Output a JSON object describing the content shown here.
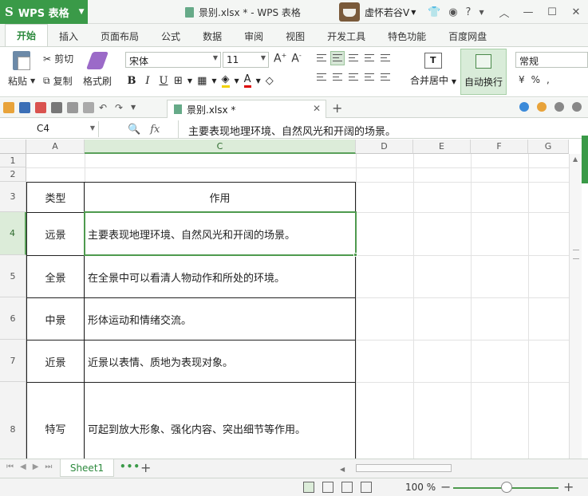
{
  "titlebar": {
    "app_button": "WPS 表格",
    "doc_title": "景别.xlsx * - WPS 表格",
    "user_name": "虚怀若谷V"
  },
  "ribbon_tabs": [
    "开始",
    "插入",
    "页面布局",
    "公式",
    "数据",
    "审阅",
    "视图",
    "开发工具",
    "特色功能",
    "百度网盘"
  ],
  "ribbon": {
    "paste": "粘贴",
    "cut": "剪切",
    "copy": "复制",
    "format_painter": "格式刷",
    "font_name": "宋体",
    "font_size": "11",
    "merge_center": "合并居中",
    "wrap_text": "自动换行",
    "number_format": "常规"
  },
  "doc_tab": {
    "label": "景别.xlsx *"
  },
  "formula_bar": {
    "name_box": "C4",
    "fx": "fx",
    "content": "主要表现地理环境、自然风光和开阔的场景。"
  },
  "columns": [
    "A",
    "C",
    "D",
    "E",
    "F",
    "G"
  ],
  "rows": [
    "1",
    "2",
    "3",
    "4",
    "5",
    "6",
    "7",
    "8"
  ],
  "table": {
    "header": {
      "type": "类型",
      "usage": "作用"
    },
    "rows": [
      {
        "type": "远景",
        "usage": "主要表现地理环境、自然风光和开阔的场景。"
      },
      {
        "type": "全景",
        "usage": "在全景中可以看清人物动作和所处的环境。"
      },
      {
        "type": "中景",
        "usage": "形体运动和情绪交流。"
      },
      {
        "type": "近景",
        "usage": "近景以表情、质地为表现对象。"
      },
      {
        "type": "特写",
        "usage": "可起到放大形象、强化内容、突出细节等作用。"
      }
    ]
  },
  "sheet": {
    "tab": "Sheet1"
  },
  "status": {
    "zoom": "100 %"
  },
  "colors": {
    "accent": "#3a9a48",
    "selection": "#4e9a4e"
  }
}
